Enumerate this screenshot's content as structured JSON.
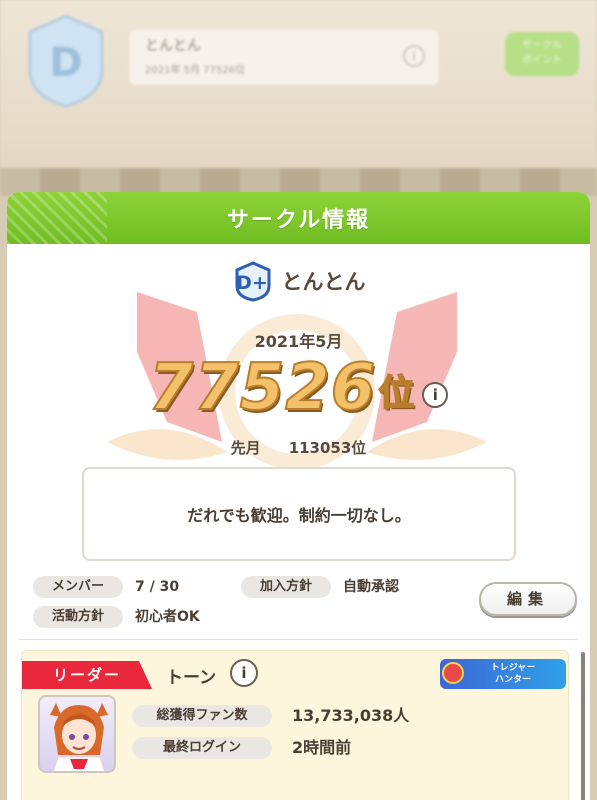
{
  "background": {
    "name": "とんとん",
    "sub": "2021年 5月 77526位",
    "button": "サークル\nポイント"
  },
  "modal": {
    "title": "サークル情報",
    "crest_label": "D+",
    "circle_name": "とんとん",
    "month": "2021年5月",
    "rank": "77526",
    "rank_unit": "位",
    "info_glyph": "i",
    "last_month_label": "先月",
    "last_month_value": "113053位",
    "message": "だれでも歓迎。制約一切なし。",
    "members_label": "メンバー",
    "members_value": "7 / 30",
    "join_policy_label": "加入方針",
    "join_policy_value": "自動承認",
    "activity_label": "活動方針",
    "activity_value": "初心者OK",
    "edit_button": "編集"
  },
  "leader": {
    "tag": "リーダー",
    "name": "トーン",
    "badge": "トレジャー\nハンター",
    "fans_label": "総獲得ファン数",
    "fans_value": "13,733,038人",
    "login_label": "最終ログイン",
    "login_value": "2時間前"
  },
  "colors": {
    "header_green": "#7cc52a",
    "leader_red": "#e9283b",
    "rank_gold": "#f3c16a",
    "badge_blue": "#2f7fe0"
  }
}
